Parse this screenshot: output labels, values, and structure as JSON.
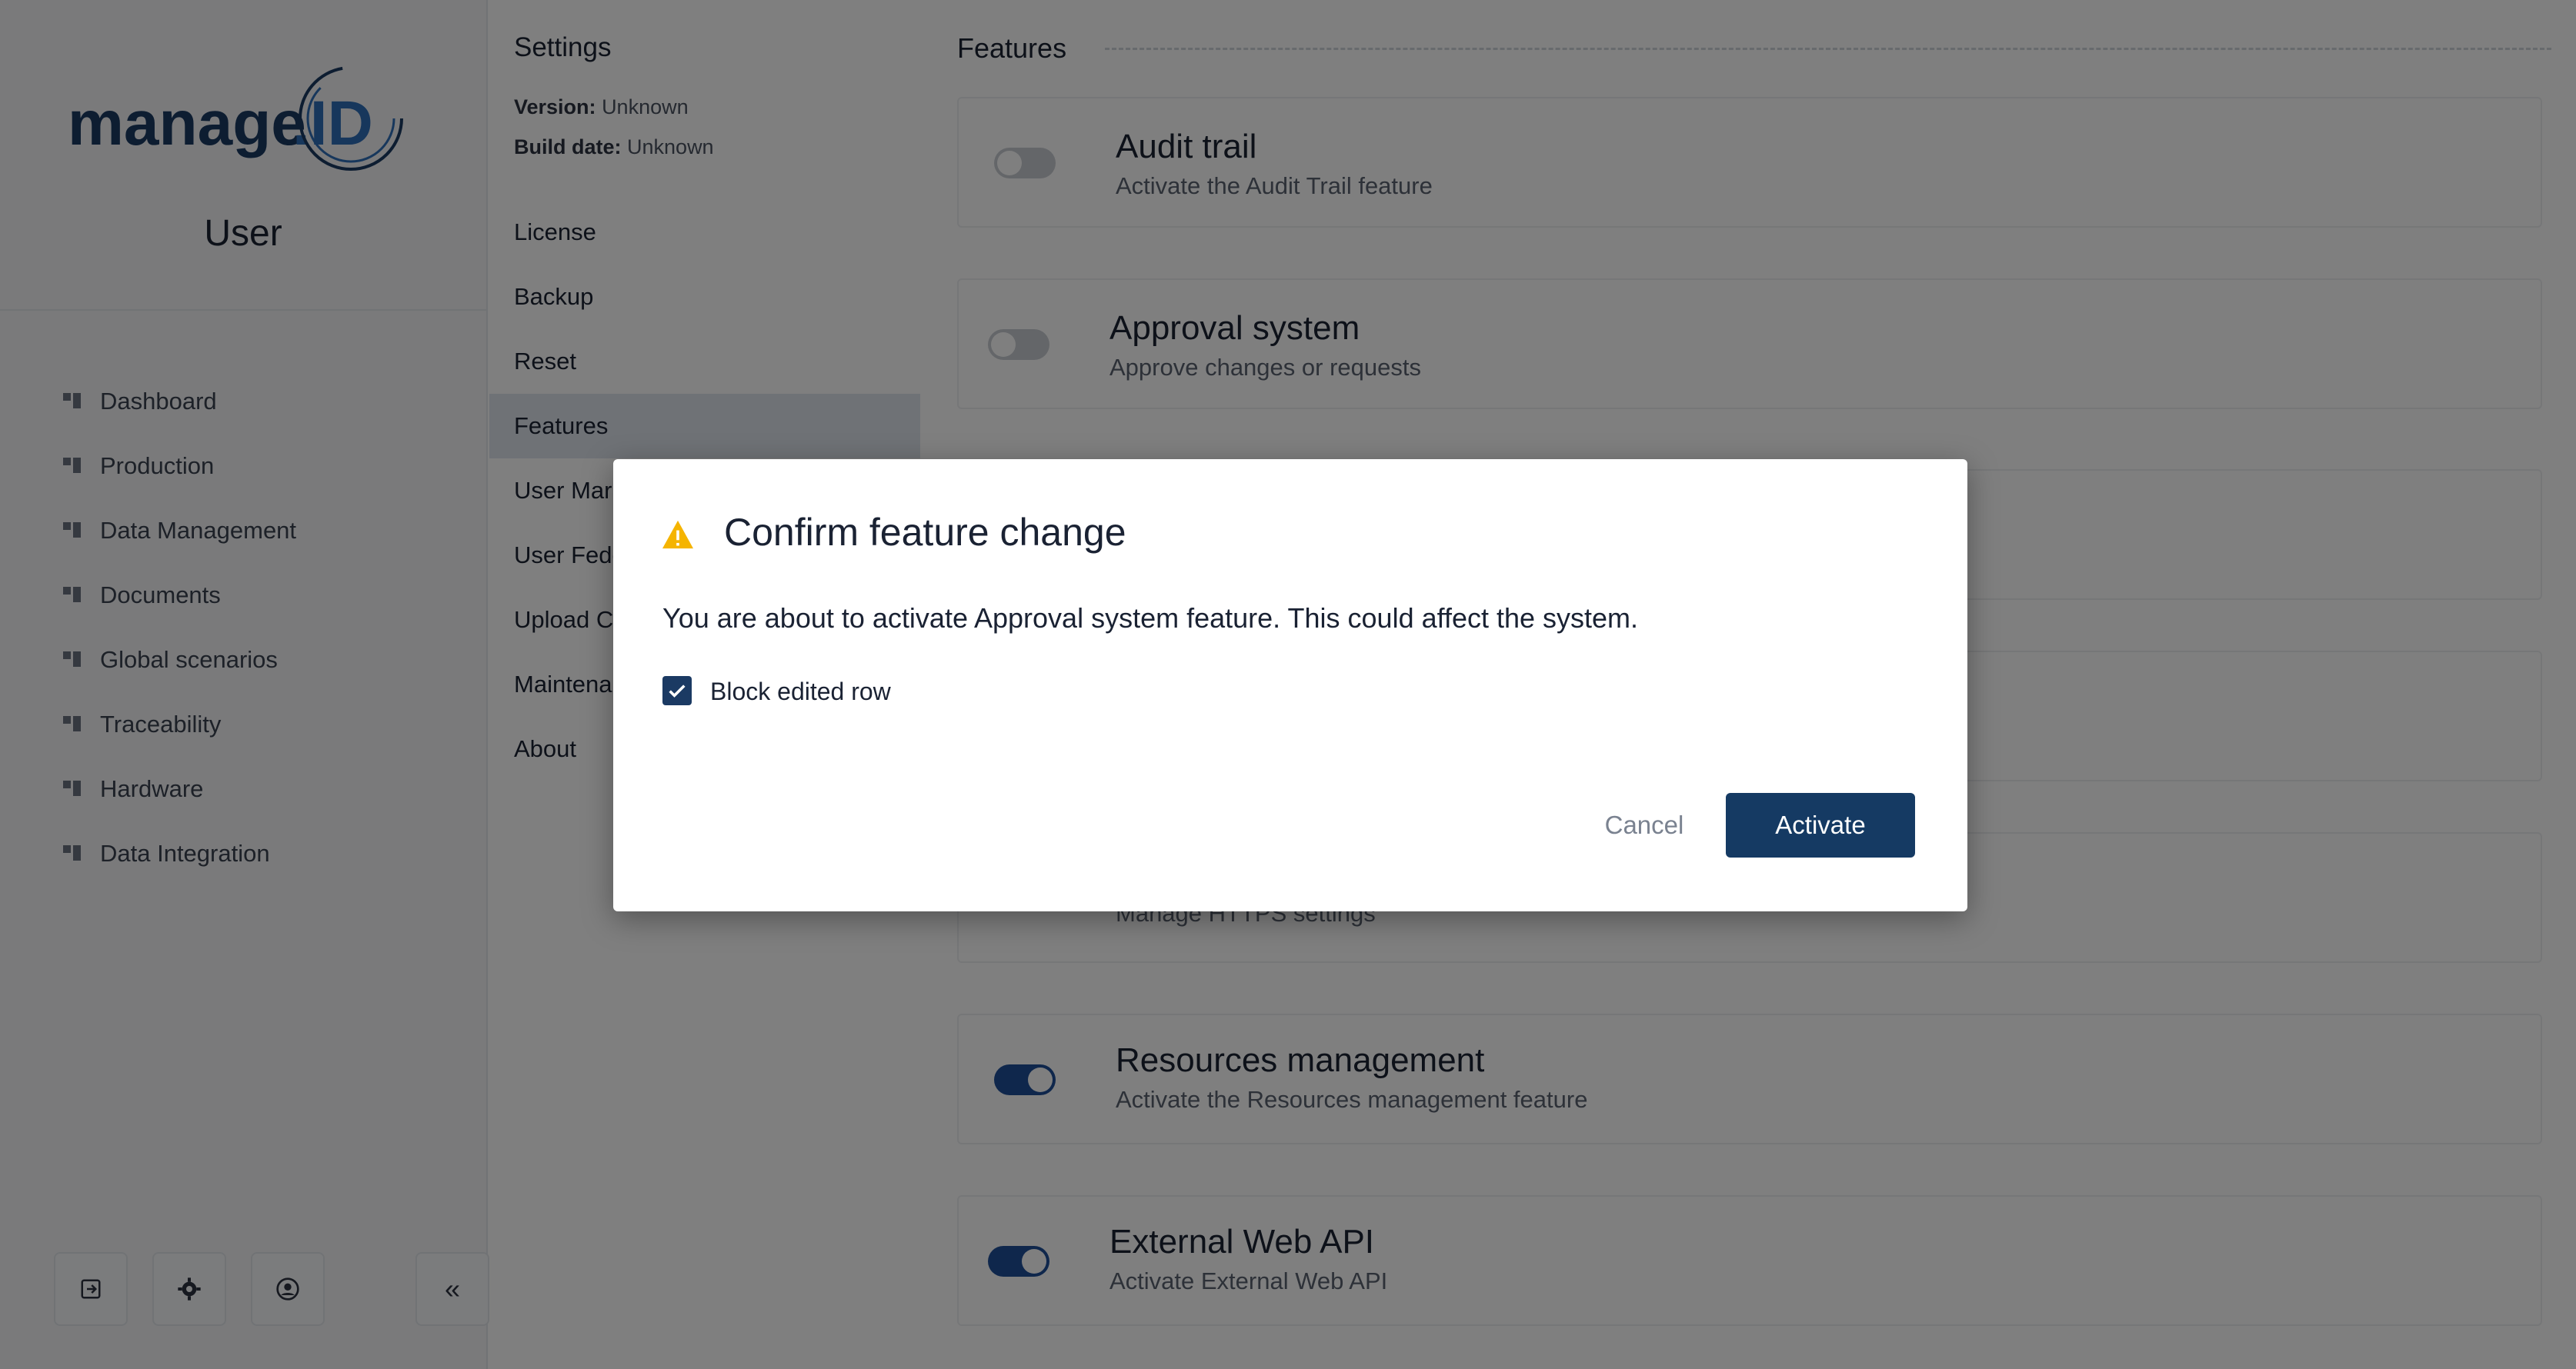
{
  "app": {
    "logo_text": "manage.ID",
    "user_role": "User"
  },
  "nav": {
    "items": [
      {
        "label": "Dashboard",
        "icon": "dashboard-icon"
      },
      {
        "label": "Production",
        "icon": "production-icon"
      },
      {
        "label": "Data Management",
        "icon": "database-icon"
      },
      {
        "label": "Documents",
        "icon": "documents-icon"
      },
      {
        "label": "Global scenarios",
        "icon": "scenarios-icon"
      },
      {
        "label": "Traceability",
        "icon": "traceability-icon"
      },
      {
        "label": "Hardware",
        "icon": "hardware-icon"
      },
      {
        "label": "Data Integration",
        "icon": "integration-icon"
      }
    ],
    "bottom_buttons": [
      "logout-icon",
      "settings-gear-icon",
      "account-icon"
    ],
    "collapse_label": "«"
  },
  "settings": {
    "title": "Settings",
    "version_label": "Version:",
    "version_value": "Unknown",
    "build_label": "Build date:",
    "build_value": "Unknown",
    "items": [
      "License",
      "Backup",
      "Reset",
      "Features",
      "User Mar",
      "User Fede",
      "Upload C",
      "Maintena",
      "About"
    ],
    "active_item": "Features"
  },
  "features": {
    "header": "Features",
    "cards": [
      {
        "title": "Audit trail",
        "description": "Activate the Audit Trail feature",
        "enabled": false
      },
      {
        "title": "Approval system",
        "description": "Approve changes or requests",
        "enabled": false
      },
      {
        "title": "",
        "description": "Manage HTTPS settings",
        "enabled": false
      },
      {
        "title": "Resources management",
        "description": "Activate the Resources management feature",
        "enabled": true
      },
      {
        "title": "External Web API",
        "description": "Activate External Web API",
        "enabled": true
      }
    ]
  },
  "dialog": {
    "title": "Confirm feature change",
    "icon": "warning-icon",
    "message": "You are about to activate Approval system feature. This could affect the system.",
    "checkbox_label": "Block edited row",
    "checkbox_checked": true,
    "cancel_label": "Cancel",
    "confirm_label": "Activate"
  },
  "colors": {
    "primary": "#153a63",
    "toggle_on": "#1f4e99",
    "warning": "#f5b400",
    "logo_blue": "#1b3a63"
  }
}
